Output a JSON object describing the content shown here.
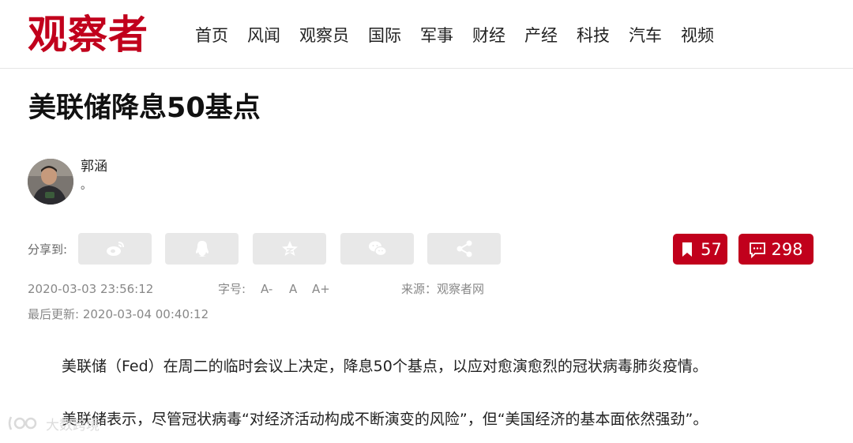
{
  "header": {
    "logo_text": "观察者",
    "nav": [
      "首页",
      "风闻",
      "观察员",
      "国际",
      "军事",
      "财经",
      "产经",
      "科技",
      "汽车",
      "视频"
    ]
  },
  "article": {
    "title": "美联储降息50基点",
    "author": {
      "name": "郭涵",
      "bio": "。"
    },
    "share": {
      "label": "分享到:",
      "icons": [
        "weibo-icon",
        "qq-icon",
        "qzone-icon",
        "wechat-icon",
        "share-icon"
      ]
    },
    "collect_count": "57",
    "comment_count": "298",
    "publish_time": "2020-03-03 23:56:12",
    "font_size": {
      "label": "字号:",
      "small": "A-",
      "normal": "A",
      "large": "A+"
    },
    "source": "来源：观察者网",
    "updated": "最后更新: 2020-03-04 00:40:12",
    "paragraphs": [
      "美联储（Fed）在周二的临时会议上决定，降息50个基点，以应对愈演愈烈的冠状病毒肺炎疫情。",
      "美联储表示，尽管冠状病毒“对经济活动构成不断演变的风险”，但“美国经济的基本面依然强劲”。"
    ]
  },
  "watermark": {
    "text": "大数跨境"
  },
  "colors": {
    "brand": "#c1001c",
    "share_bg": "#e8e8e8",
    "meta": "#888888"
  }
}
